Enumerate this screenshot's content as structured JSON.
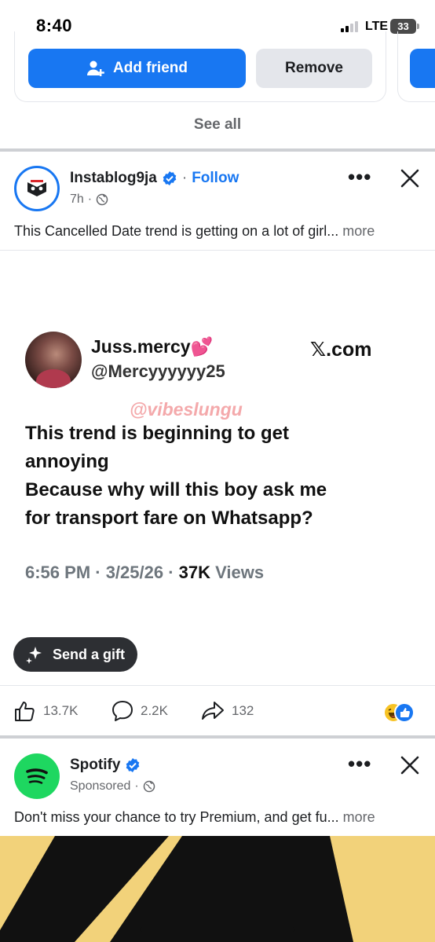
{
  "status_bar": {
    "time": "8:40",
    "network": "LTE",
    "battery": "33"
  },
  "suggestions": {
    "add_friend_label": "Add friend",
    "remove_label": "Remove",
    "see_all_label": "See all"
  },
  "post": {
    "author": "Instablog9ja",
    "follow_label": "Follow",
    "time": "7h",
    "caption": "This Cancelled Date trend is getting on a lot of girl...",
    "more_label": "more",
    "tweet": {
      "name": "Juss.mercy💕",
      "handle": "@Mercyyyyyy25",
      "site": "𝕏.com",
      "watermark": "@vibeslungu",
      "body_lines": [
        "This trend is beginning to get",
        "annoying",
        "Because why will this boy ask me",
        "for transport fare on Whatsapp?"
      ],
      "stats_time": "6:56 PM · 3/25/26 · ",
      "stats_views_count": "37K",
      "stats_views_label": " Views"
    },
    "gift_label": "Send a gift",
    "likes": "13.7K",
    "comments": "2.2K",
    "shares": "132"
  },
  "ad": {
    "author": "Spotify",
    "sponsored_label": "Sponsored",
    "caption": "Don't miss your chance to try Premium, and get fu...",
    "more_label": "more"
  },
  "colors": {
    "brand_blue": "#1877f2",
    "spotify_green": "#1ed760",
    "divider": "#ced0d4"
  }
}
